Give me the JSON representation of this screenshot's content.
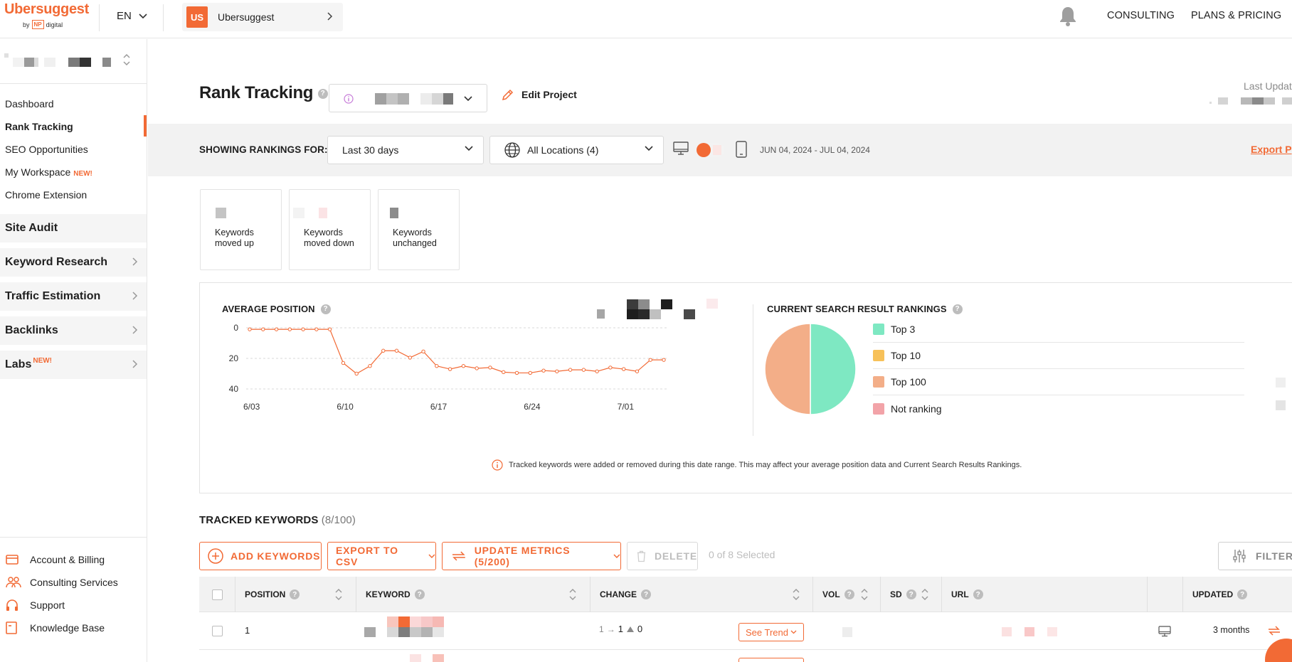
{
  "brand": {
    "name": "Ubersuggest",
    "by": "by",
    "np": "NP",
    "digital": "digital"
  },
  "header": {
    "language": "EN",
    "project": {
      "initials": "US",
      "name": "Ubersuggest"
    },
    "consulting": "CONSULTING",
    "plans_pricing": "PLANS & PRICING"
  },
  "sidebar": {
    "items": [
      {
        "label": "Dashboard"
      },
      {
        "label": "Rank Tracking",
        "active": true
      },
      {
        "label": "SEO Opportunities"
      },
      {
        "label": "My Workspace",
        "badge": "NEW!"
      },
      {
        "label": "Chrome Extension"
      }
    ],
    "sections": [
      {
        "label": "Site Audit"
      },
      {
        "label": "Keyword Research"
      },
      {
        "label": "Traffic Estimation"
      },
      {
        "label": "Backlinks"
      },
      {
        "label": "Labs",
        "badge": "NEW!"
      }
    ],
    "bottom": [
      {
        "label": "Account & Billing",
        "icon": "credit-card-icon"
      },
      {
        "label": "Consulting Services",
        "icon": "people-icon"
      },
      {
        "label": "Support",
        "icon": "headset-icon"
      },
      {
        "label": "Knowledge Base",
        "icon": "book-icon"
      }
    ]
  },
  "page": {
    "title": "Rank Tracking",
    "help": "?",
    "edit_project": "Edit Project",
    "last_update": "Last Update"
  },
  "filters": {
    "label": "SHOWING RANKINGS FOR:",
    "period": "Last 30 days",
    "locations": "All Locations (4)",
    "date_range": "JUN 04, 2024 - JUL 04, 2024",
    "export": "Export P"
  },
  "stats": [
    {
      "line1": "Keywords",
      "line2": "moved up"
    },
    {
      "line1": "Keywords",
      "line2": "moved down"
    },
    {
      "line1": "Keywords",
      "line2": "unchanged"
    }
  ],
  "average_position": {
    "title": "AVERAGE POSITION"
  },
  "rankings": {
    "title": "CURRENT SEARCH RESULT RANKINGS",
    "legend": [
      {
        "label": "Top 3",
        "color": "#7ee8c2"
      },
      {
        "label": "Top 10",
        "color": "#f7c159"
      },
      {
        "label": "Top 100",
        "color": "#f3ae88"
      },
      {
        "label": "Not ranking",
        "color": "#f2a3a8"
      }
    ]
  },
  "chart_data": [
    {
      "type": "line",
      "title": "AVERAGE POSITION",
      "x_ticks": [
        "6/03",
        "6/10",
        "6/17",
        "6/24",
        "7/01"
      ],
      "y_ticks": [
        "0",
        "20",
        "40"
      ],
      "ylim": [
        0,
        40
      ],
      "y_inverted": true,
      "grid": true,
      "color": "#f26a35",
      "x": [
        "6/03",
        "6/04",
        "6/05",
        "6/06",
        "6/07",
        "6/08",
        "6/09",
        "6/10",
        "6/11",
        "6/12",
        "6/13",
        "6/14",
        "6/15",
        "6/16",
        "6/17",
        "6/18",
        "6/19",
        "6/20",
        "6/21",
        "6/22",
        "6/23",
        "6/24",
        "6/25",
        "6/26",
        "6/27",
        "6/28",
        "6/29",
        "6/30",
        "7/01",
        "7/02",
        "7/03"
      ],
      "values": [
        1,
        1,
        1,
        1,
        1,
        1,
        1,
        23,
        30,
        25,
        15,
        15,
        19.5,
        15.5,
        25,
        27,
        25,
        26.5,
        26,
        29,
        29.5,
        29.5,
        28,
        28.5,
        27.5,
        27.5,
        28.5,
        26,
        27,
        28.5,
        21,
        21
      ]
    },
    {
      "type": "pie",
      "title": "CURRENT SEARCH RESULT RANKINGS",
      "categories": [
        "Top 3",
        "Top 10",
        "Top 100",
        "Not ranking"
      ],
      "values": [
        50,
        0,
        50,
        0
      ],
      "colors": [
        "#7ee8c2",
        "#f7c159",
        "#f3ae88",
        "#f2a3a8"
      ]
    }
  ],
  "notice": "Tracked keywords were added or removed during this date range. This may affect your average position data and Current Search Results Rankings.",
  "tracked": {
    "title": "TRACKED KEYWORDS",
    "count": "(8/100)",
    "add": "ADD KEYWORDS",
    "export": "EXPORT TO CSV",
    "update": "UPDATE METRICS (5/200)",
    "delete": "DELETE",
    "selected": "0 of 8 Selected",
    "filter": "FILTER",
    "columns": {
      "position": "POSITION",
      "keyword": "KEYWORD",
      "change": "CHANGE",
      "vol": "VOL",
      "sd": "SD",
      "url": "URL",
      "updated": "UPDATED"
    },
    "rows": [
      {
        "position": "1",
        "change_from": "1",
        "change_arrow": "→",
        "change_to": "1",
        "change_delta": "0",
        "see_trend": "See Trend",
        "updated": "3 months"
      }
    ]
  }
}
